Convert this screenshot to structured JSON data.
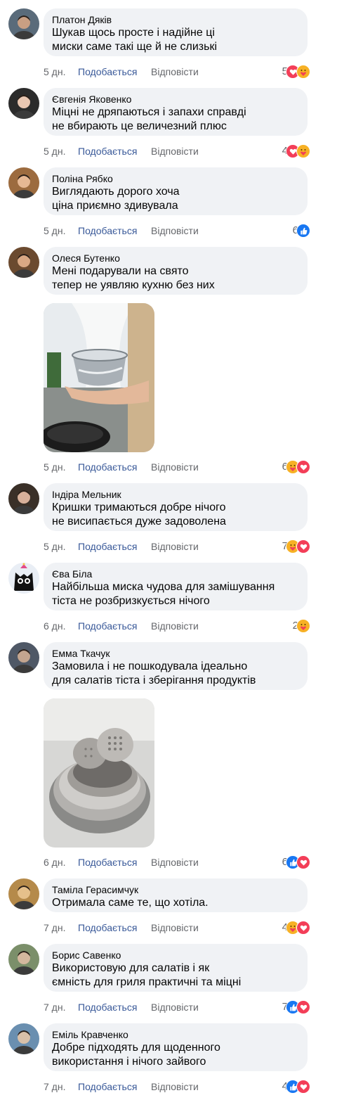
{
  "meta_labels": {
    "like": "Подобається",
    "reply": "Відповісти"
  },
  "comments": [
    {
      "author": "Платон Дяків",
      "lines": [
        "Шукав щось просте і надійне ці",
        "миски саме такі ще й не слизькі"
      ],
      "time": "5 дн.",
      "count": "5",
      "reactions": [
        "love",
        "care"
      ]
    },
    {
      "author": "Євгенія Яковенко",
      "lines": [
        "Міцні не дряпаються і запахи справді",
        "не вбирають це величезний плюс"
      ],
      "time": "5 дн.",
      "count": "4",
      "reactions": [
        "love",
        "care"
      ]
    },
    {
      "author": "Поліна Рябко",
      "lines": [
        "Виглядають дорого хоча",
        "ціна приємно здивувала"
      ],
      "time": "5 дн.",
      "count": "6",
      "reactions": [
        "like"
      ]
    },
    {
      "author": "Олеся Бутенко",
      "lines": [
        "Мені подарували на свято",
        "тепер не уявляю кухню без них"
      ],
      "time": "5 дн.",
      "count": "6",
      "reactions": [
        "care",
        "love"
      ],
      "image": "photo-hand-holding-bowl"
    },
    {
      "author": "Індіра Мельник",
      "lines": [
        "Кришки тримаються добре нічого",
        "не висипається дуже задоволена"
      ],
      "time": "5 дн.",
      "count": "7",
      "reactions": [
        "care",
        "love"
      ]
    },
    {
      "author": "Єва Біла",
      "lines": [
        "Найбільша миска чудова для замішування",
        "тіста не розбризкується нічого"
      ],
      "time": "6 дн.",
      "count": "2",
      "reactions": [
        "care"
      ]
    },
    {
      "author": "Емма Ткачук",
      "lines": [
        "Замовила і не пошкодувала ідеально",
        "для салатів тіста і зберігання продуктів"
      ],
      "time": "6 дн.",
      "count": "6",
      "reactions": [
        "like",
        "love"
      ],
      "image": "photo-stacked-bowls-with-graters"
    },
    {
      "author": "Таміла Герасимчук",
      "lines": [
        "Отримала саме те, що хотіла."
      ],
      "time": "7 дн.",
      "count": "4",
      "reactions": [
        "care",
        "love"
      ]
    },
    {
      "author": "Борис Савенко",
      "lines": [
        "Використовую для салатів і як",
        "ємність для гриля практичні та міцні"
      ],
      "time": "7 дн.",
      "count": "7",
      "reactions": [
        "like",
        "love"
      ]
    },
    {
      "author": "Еміль Кравченко",
      "lines": [
        "Добре підходять для щоденного",
        "використання і нічого зайвого"
      ],
      "time": "7 дн.",
      "count": "4",
      "reactions": [
        "like",
        "love"
      ]
    }
  ]
}
